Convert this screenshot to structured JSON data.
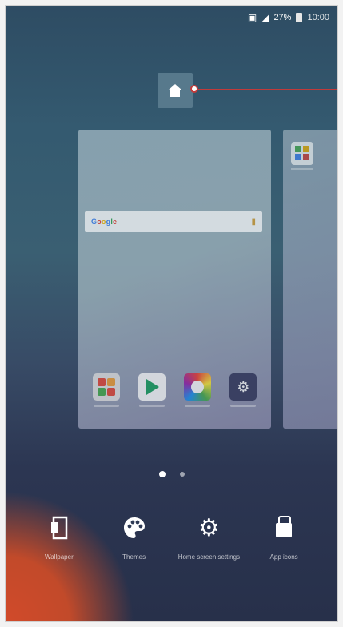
{
  "status_bar": {
    "nfc_icon": "nfc-icon",
    "signal_icon": "signal-icon",
    "battery_percent": "27%",
    "clock": "10:00"
  },
  "home_indicator": {
    "icon": "home-icon"
  },
  "search_bar": {
    "logo_letters": [
      "G",
      "o",
      "o",
      "g",
      "l",
      "e"
    ],
    "mic_icon": "mic-icon"
  },
  "card_apps": [
    {
      "name": "apps-icon"
    },
    {
      "name": "play-store-icon"
    },
    {
      "name": "camera-icon"
    },
    {
      "name": "settings-icon"
    }
  ],
  "page_indicator": {
    "current": 1,
    "total": 2
  },
  "bottom_actions": [
    {
      "label": "Wallpaper",
      "icon": "wallpaper-icon"
    },
    {
      "label": "Themes",
      "icon": "palette-icon"
    },
    {
      "label": "Home screen settings",
      "icon": "gear-icon"
    },
    {
      "label": "App icons",
      "icon": "app-icons-icon"
    }
  ],
  "colors": {
    "callout": "#c23a3a",
    "home_tile": "#57798c",
    "wallpaper_top": "#2e4c63",
    "wallpaper_bottom": "#27304a",
    "wallpaper_accent": "#d14a2a"
  }
}
